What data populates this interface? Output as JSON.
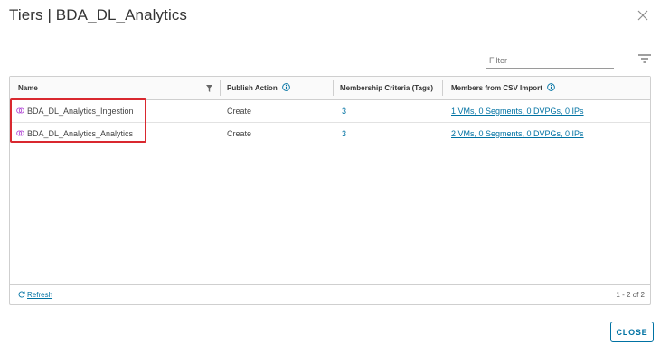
{
  "dialog": {
    "title": "Tiers | BDA_DL_Analytics",
    "close_label": "CLOSE"
  },
  "filter": {
    "placeholder": "Filter"
  },
  "table": {
    "columns": [
      "Name",
      "Publish Action",
      "Membership Criteria (Tags)",
      "Members from CSV Import"
    ],
    "rows": [
      {
        "name": "BDA_DL_Analytics_Ingestion",
        "publish_action": "Create",
        "criteria": "3",
        "csv_members": "1 VMs, 0 Segments, 0 DVPGs, 0 IPs"
      },
      {
        "name": "BDA_DL_Analytics_Analytics",
        "publish_action": "Create",
        "criteria": "3",
        "csv_members": "2 VMs, 0 Segments, 0 DVPGs, 0 IPs"
      }
    ]
  },
  "footer": {
    "refresh_label": "Refresh",
    "pagination": "1 - 2 of 2"
  },
  "colors": {
    "accent": "#0072a3",
    "highlight": "#d9282f",
    "tier_icon": "#b44fd6"
  }
}
